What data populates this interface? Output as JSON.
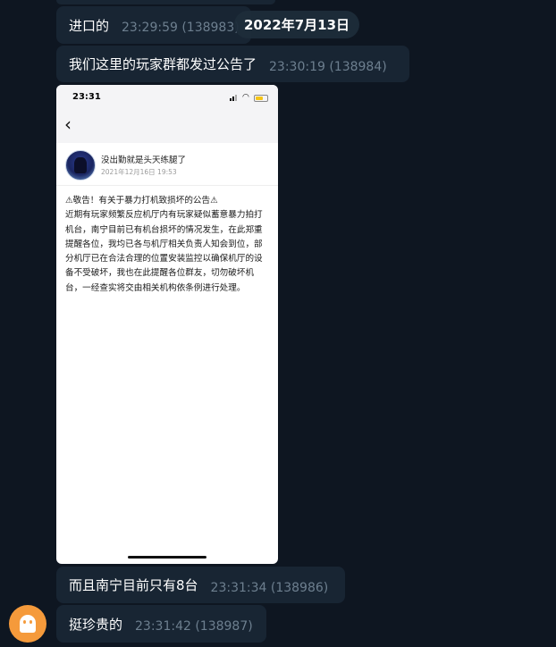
{
  "chat": {
    "date_pill": "2022年7月13日",
    "messages": [
      {
        "text": "进口的",
        "time": "23:29:59 (138983)"
      },
      {
        "text": "我们这里的玩家群都发过公告了",
        "time": "23:30:19 (138984)"
      },
      {
        "text": "而且南宁目前只有8台",
        "time": "23:31:34 (138986)"
      },
      {
        "text": "挺珍贵的",
        "time": "23:31:42 (138987)"
      }
    ]
  },
  "screenshot": {
    "status_time": "23:31",
    "back_icon": "chevron-left-icon",
    "author": "没出勤就是头天练腿了",
    "post_date": "2021年12月16日 19:53",
    "body": "⚠敬告！有关于暴力打机致损坏的公告⚠\n近期有玩家频繁反应机厅内有玩家疑似蓄意暴力拍打机台，南宁目前已有机台损坏的情况发生，在此郑重提醒各位，我均已各与机厅相关负责人知会到位，部分机厅已在合法合理的位置安装监控以确保机厅的设备不受破坏，我也在此提醒各位群友，切勿破坏机台，一经查实将交由相关机构依条例进行处理。"
  },
  "colors": {
    "background": "#0e1621",
    "bubble": "#182533",
    "timestamp": "#6d7f8f",
    "avatar": "#f59a3b"
  },
  "icons": {
    "bot_avatar": "ghost-icon",
    "wifi": "wifi-icon",
    "battery": "battery-icon",
    "signal": "signal-icon"
  }
}
